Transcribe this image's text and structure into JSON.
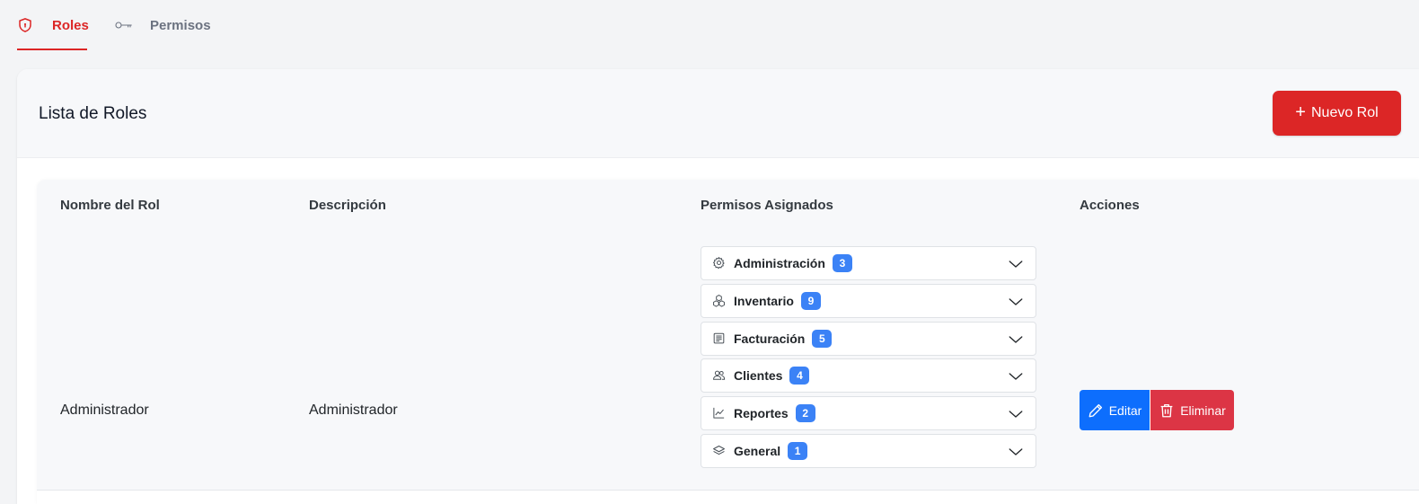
{
  "tabs": [
    {
      "label": "Roles",
      "icon": "shield-icon",
      "active": true
    },
    {
      "label": "Permisos",
      "icon": "key-icon",
      "active": false
    }
  ],
  "card": {
    "title": "Lista de Roles",
    "new_button": "Nuevo Rol"
  },
  "table": {
    "headers": {
      "name": "Nombre del Rol",
      "description": "Descripción",
      "permissions": "Permisos Asignados",
      "actions": "Acciones"
    },
    "rows": [
      {
        "name": "Administrador",
        "description": "Administrador",
        "permissions": [
          {
            "label": "Administración",
            "count": "3",
            "icon": "gear-icon"
          },
          {
            "label": "Inventario",
            "count": "9",
            "icon": "boxes-icon"
          },
          {
            "label": "Facturación",
            "count": "5",
            "icon": "invoice-icon"
          },
          {
            "label": "Clientes",
            "count": "4",
            "icon": "people-icon"
          },
          {
            "label": "Reportes",
            "count": "2",
            "icon": "chart-line-icon"
          },
          {
            "label": "General",
            "count": "1",
            "icon": "layers-icon"
          }
        ],
        "edit_label": "Editar",
        "delete_label": "Eliminar"
      }
    ]
  },
  "colors": {
    "accent": "#dc2626",
    "badge": "#3b82f6",
    "edit": "#0d6efd",
    "delete": "#dc3545"
  }
}
